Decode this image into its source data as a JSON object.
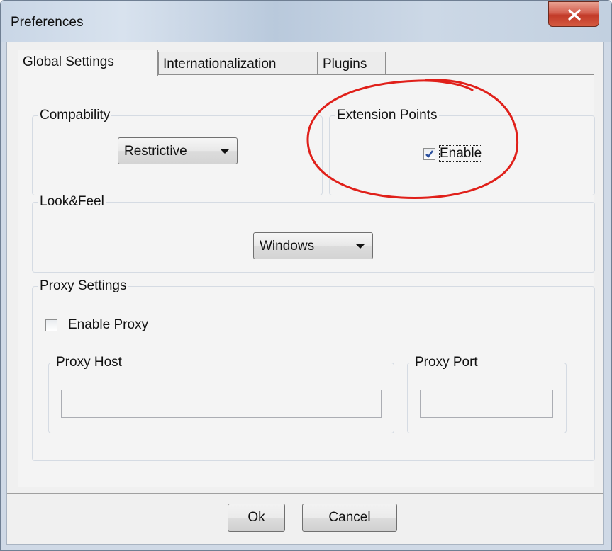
{
  "window": {
    "title": "Preferences"
  },
  "tabs": [
    {
      "label": "Global Settings",
      "active": true
    },
    {
      "label": "Internationalization",
      "active": false
    },
    {
      "label": "Plugins",
      "active": false
    }
  ],
  "compability": {
    "legend": "Compability",
    "selected": "Restrictive"
  },
  "extension_points": {
    "legend": "Extension Points",
    "enable_label": "Enable",
    "enabled": true
  },
  "look_and_feel": {
    "legend": "Look&Feel",
    "selected": "Windows"
  },
  "proxy_settings": {
    "legend": "Proxy Settings",
    "enable_proxy_label": "Enable Proxy",
    "enable_proxy_checked": false,
    "host_legend": "Proxy Host",
    "host_value": "",
    "port_legend": "Proxy Port",
    "port_value": ""
  },
  "buttons": {
    "ok_label": "Ok",
    "cancel_label": "Cancel"
  },
  "colors": {
    "annotation_circle": "#e0201a",
    "close_button": "#c9442e"
  }
}
